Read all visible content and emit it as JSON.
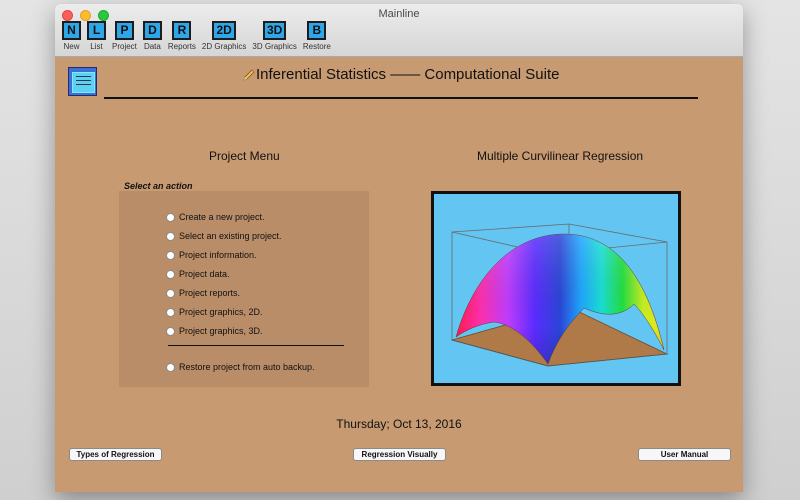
{
  "window": {
    "title": "Mainline"
  },
  "toolbar": [
    {
      "glyph": "N",
      "label": "New"
    },
    {
      "glyph": "L",
      "label": "List"
    },
    {
      "glyph": "P",
      "label": "Project"
    },
    {
      "glyph": "D",
      "label": "Data"
    },
    {
      "glyph": "R",
      "label": "Reports"
    },
    {
      "glyph": "2D",
      "label": "2D Graphics"
    },
    {
      "glyph": "3D",
      "label": "3D Graphics"
    },
    {
      "glyph": "B",
      "label": "Restore"
    }
  ],
  "header": {
    "title": "Inferential Statistics —— Computational Suite"
  },
  "project_menu": {
    "title": "Project Menu",
    "select_label": "Select an action",
    "options": [
      "Create a new project.",
      "Select an existing project.",
      "Project information.",
      "Project data.",
      "Project reports.",
      "Project graphics, 2D.",
      "Project graphics, 3D."
    ],
    "restore_option": "Restore project from auto backup."
  },
  "preview": {
    "title": "Multiple Curvilinear Regression"
  },
  "date": "Thursday; Oct 13, 2016",
  "buttons": {
    "types": "Types of Regression",
    "visual": "Regression Visually",
    "manual": "User Manual"
  },
  "colors": {
    "window_bg": "#c89a72",
    "menu_box_bg": "#b98d68",
    "toolbar_icon": "#2fa6e8",
    "chart_bg": "#62c5f2",
    "chart_floor": "#b07a48"
  }
}
